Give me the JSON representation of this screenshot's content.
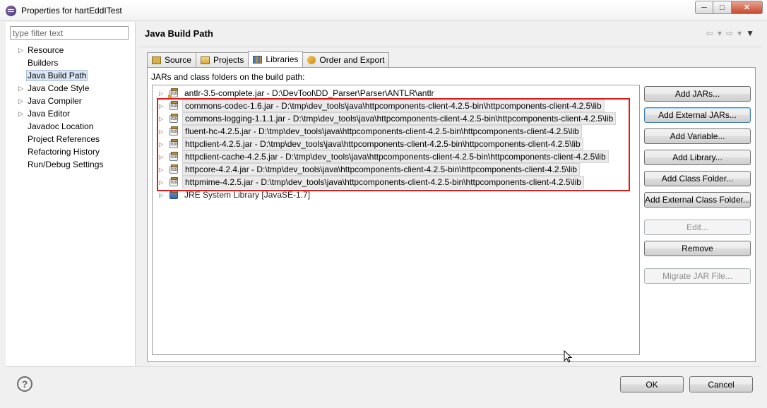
{
  "window": {
    "title": "Properties for hartEddITest"
  },
  "filter": {
    "placeholder": "type filter text"
  },
  "nav": [
    {
      "label": "Resource",
      "expandable": true
    },
    {
      "label": "Builders",
      "expandable": false
    },
    {
      "label": "Java Build Path",
      "expandable": false,
      "selected": true
    },
    {
      "label": "Java Code Style",
      "expandable": true
    },
    {
      "label": "Java Compiler",
      "expandable": true
    },
    {
      "label": "Java Editor",
      "expandable": true
    },
    {
      "label": "Javadoc Location",
      "expandable": false
    },
    {
      "label": "Project References",
      "expandable": false
    },
    {
      "label": "Refactoring History",
      "expandable": false
    },
    {
      "label": "Run/Debug Settings",
      "expandable": false
    }
  ],
  "page": {
    "title": "Java Build Path"
  },
  "tabs": [
    {
      "label": "Source",
      "icon": "source-folder-icon"
    },
    {
      "label": "Projects",
      "icon": "projects-icon"
    },
    {
      "label": "Libraries",
      "icon": "libraries-icon",
      "active": true
    },
    {
      "label": "Order and Export",
      "icon": "order-export-icon"
    }
  ],
  "libraries": {
    "description": "JARs and class folders on the build path:",
    "entries": [
      {
        "label": "antlr-3.5-complete.jar - D:\\DevTool\\DD_Parser\\Parser\\ANTLR\\antlr",
        "highlighted": false,
        "kind": "jar-folder"
      },
      {
        "label": "commons-codec-1.6.jar - D:\\tmp\\dev_tools\\java\\httpcomponents-client-4.2.5-bin\\httpcomponents-client-4.2.5\\lib",
        "highlighted": true,
        "kind": "jar"
      },
      {
        "label": "commons-logging-1.1.1.jar - D:\\tmp\\dev_tools\\java\\httpcomponents-client-4.2.5-bin\\httpcomponents-client-4.2.5\\lib",
        "highlighted": true,
        "kind": "jar"
      },
      {
        "label": "fluent-hc-4.2.5.jar - D:\\tmp\\dev_tools\\java\\httpcomponents-client-4.2.5-bin\\httpcomponents-client-4.2.5\\lib",
        "highlighted": true,
        "kind": "jar"
      },
      {
        "label": "httpclient-4.2.5.jar - D:\\tmp\\dev_tools\\java\\httpcomponents-client-4.2.5-bin\\httpcomponents-client-4.2.5\\lib",
        "highlighted": true,
        "kind": "jar"
      },
      {
        "label": "httpclient-cache-4.2.5.jar - D:\\tmp\\dev_tools\\java\\httpcomponents-client-4.2.5-bin\\httpcomponents-client-4.2.5\\lib",
        "highlighted": true,
        "kind": "jar"
      },
      {
        "label": "httpcore-4.2.4.jar - D:\\tmp\\dev_tools\\java\\httpcomponents-client-4.2.5-bin\\httpcomponents-client-4.2.5\\lib",
        "highlighted": true,
        "kind": "jar"
      },
      {
        "label": "httpmime-4.2.5.jar - D:\\tmp\\dev_tools\\java\\httpcomponents-client-4.2.5-bin\\httpcomponents-client-4.2.5\\lib",
        "highlighted": true,
        "kind": "jar"
      },
      {
        "label": "JRE System Library [JavaSE-1.7]",
        "highlighted": false,
        "kind": "jre"
      }
    ]
  },
  "buttons": [
    {
      "name": "add-jars-button",
      "label": "Add JARs...",
      "enabled": true
    },
    {
      "name": "add-external-jars-button",
      "label": "Add External JARs...",
      "enabled": true,
      "default": true
    },
    {
      "name": "add-variable-button",
      "label": "Add Variable...",
      "enabled": true
    },
    {
      "name": "add-library-button",
      "label": "Add Library...",
      "enabled": true
    },
    {
      "name": "add-class-folder-button",
      "label": "Add Class Folder...",
      "enabled": true
    },
    {
      "name": "add-external-class-folder-button",
      "label": "Add External Class Folder...",
      "enabled": true
    },
    {
      "name": "edit-button",
      "label": "Edit...",
      "enabled": false
    },
    {
      "name": "remove-button",
      "label": "Remove",
      "enabled": true
    },
    {
      "name": "migrate-jar-file-button",
      "label": "Migrate JAR File...",
      "enabled": false
    }
  ],
  "footer": {
    "ok_label": "OK",
    "cancel_label": "Cancel"
  },
  "colors": {
    "highlight_box": "#e01a1a",
    "selection": "#dbe6f4"
  }
}
